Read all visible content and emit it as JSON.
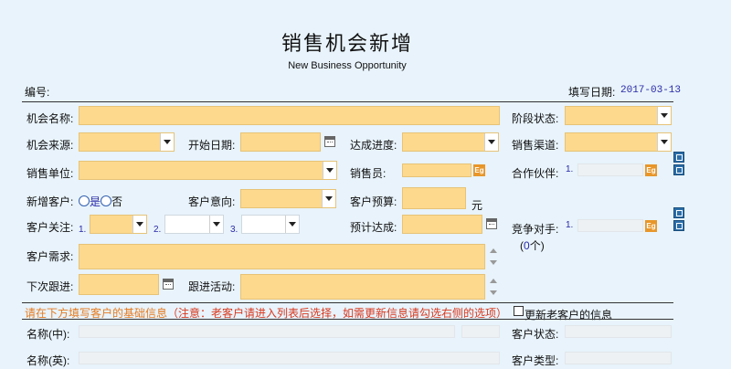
{
  "header": {
    "title": "销售机会新增",
    "subtitle": "New Business Opportunity"
  },
  "meta": {
    "number_label": "编号:",
    "fill_date_label": "填写日期:",
    "fill_date_value": "2017-03-13"
  },
  "form": {
    "opp_name_label": "机会名称:",
    "stage_label": "阶段状态:",
    "source_label": "机会来源:",
    "start_date_label": "开始日期:",
    "progress_label": "达成进度:",
    "channel_label": "销售渠道:",
    "sales_unit_label": "销售单位:",
    "salesperson_label": "销售员:",
    "partner_label": "合作伙伴:",
    "partner_index": "1.",
    "new_customer_label": "新增客户:",
    "yes_label": "是",
    "no_label": "否",
    "intent_label": "客户意向:",
    "budget_label": "客户预算:",
    "budget_unit": "元",
    "focus_label": "客户关注:",
    "focus_1": "1.",
    "focus_2": "2.",
    "focus_3": "3.",
    "expected_label": "预计达成:",
    "competitor_label": "竞争对手:",
    "competitor_index": "1.",
    "competitor_count_prefix": "(",
    "competitor_count": "0",
    "competitor_count_suffix": "个)",
    "need_label": "客户需求:",
    "next_follow_label": "下次跟进:",
    "follow_activity_label": "跟进活动:",
    "eg_icon_text": "Eg"
  },
  "notice": {
    "part1": "请在下方填写客户的基础信息",
    "part2": "（注意：老客户请进入列表后选择，如需更新信息请勾选右侧的选项）",
    "checkbox_label": "更新老客户的信息"
  },
  "customer": {
    "name_cn_label": "名称(中):",
    "name_en_label": "名称(英):",
    "status_label": "客户状态:",
    "type_label": "客户类型:"
  },
  "colors": {
    "field_bg": "#fdd98e",
    "page_bg": "#e8f3fb",
    "notice": "#d9381e",
    "accent_blue": "#2a2aa8"
  }
}
